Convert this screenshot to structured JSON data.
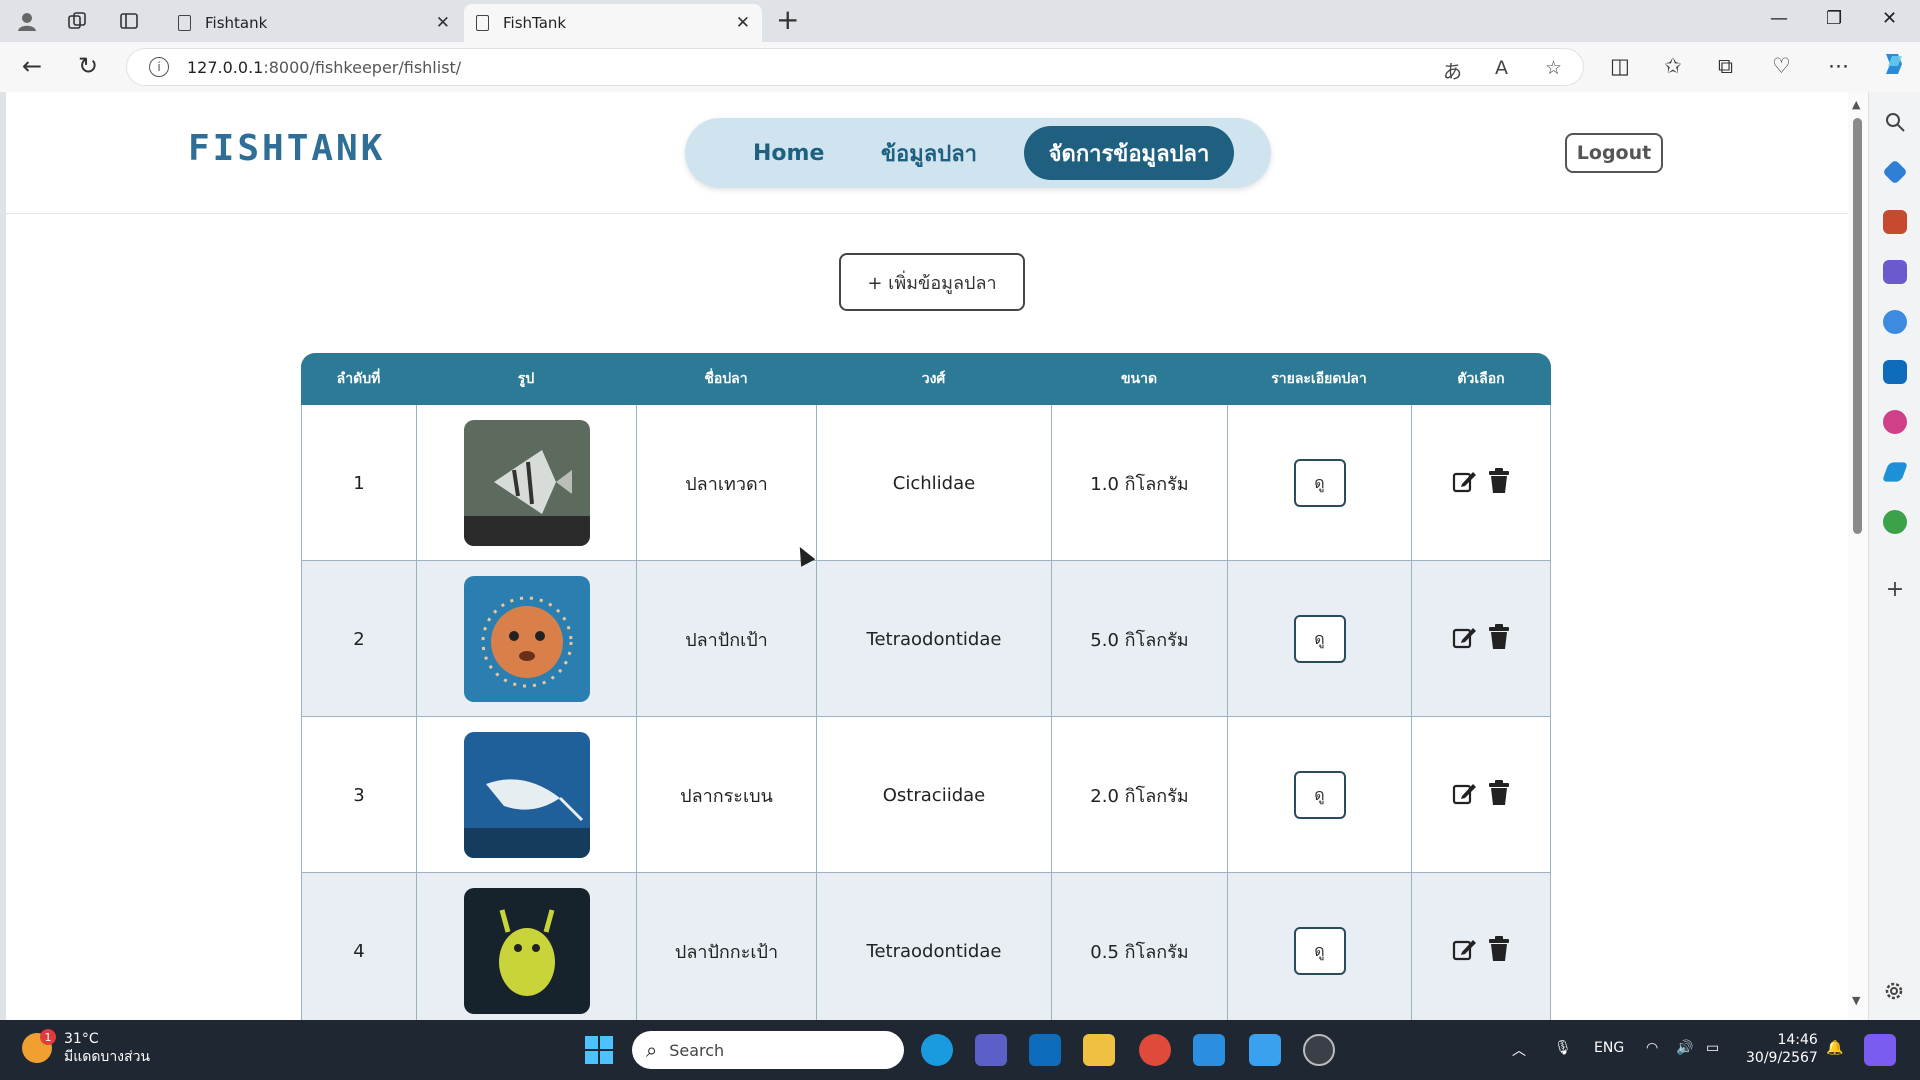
{
  "browser": {
    "tabs": [
      {
        "title": "Fishtank",
        "active": false
      },
      {
        "title": "FishTank",
        "active": true
      }
    ],
    "url_host": "127.0.0.1",
    "url_rest": ":8000/fishkeeper/fishlist/"
  },
  "site": {
    "logo": "FISHTANK",
    "nav": {
      "home": "Home",
      "fish_info": "ข้อมูลปลา",
      "manage": "จัดการข้อมูลปลา"
    },
    "logout": "Logout",
    "add_button": "+ เพิ่มข้อมูลปลา"
  },
  "table": {
    "headers": [
      "ลำดับที่",
      "รูป",
      "ชื่อปลา",
      "วงศ์",
      "ขนาด",
      "รายละเอียดปลา",
      "ตัวเลือก"
    ],
    "view_label": "ดู",
    "rows": [
      {
        "no": "1",
        "name": "ปลาเทวดา",
        "family": "Cichlidae",
        "size": "1.0 กิโลกรัม"
      },
      {
        "no": "2",
        "name": "ปลาปักเป้า",
        "family": "Tetraodontidae",
        "size": "5.0 กิโลกรัม"
      },
      {
        "no": "3",
        "name": "ปลากระเบน",
        "family": "Ostraciidae",
        "size": "2.0 กิโลกรัม"
      },
      {
        "no": "4",
        "name": "ปลาปักกะเป้า",
        "family": "Tetraodontidae",
        "size": "0.5 กิโลกรัม"
      }
    ]
  },
  "taskbar": {
    "weather_temp": "31°C",
    "weather_desc": "มีแดดบางส่วน",
    "weather_badge": "1",
    "search": "Search",
    "lang": "ENG",
    "time": "14:46",
    "date": "30/9/2567"
  },
  "colors": {
    "brand": "#2c7a96",
    "nav_active": "#1f5f80",
    "nav_bg": "#cfe4ef"
  }
}
